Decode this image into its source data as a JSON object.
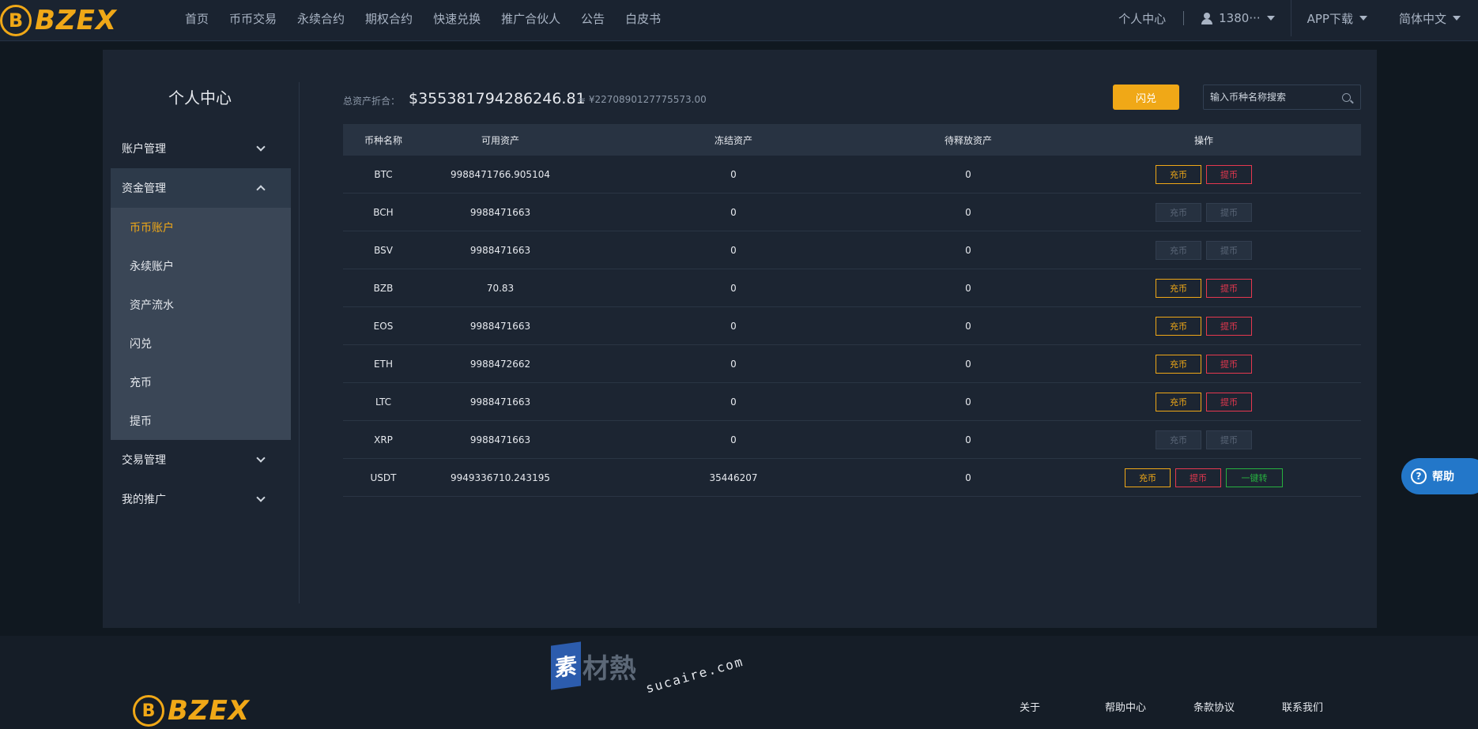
{
  "brand": {
    "name": "BZEX",
    "mark": "B"
  },
  "nav": {
    "items": [
      "首页",
      "币币交易",
      "永续合约",
      "期权合约",
      "快速兑换",
      "推广合伙人",
      "公告",
      "白皮书"
    ],
    "personal_center": "个人中心",
    "user": "1380···",
    "app_download": "APP下载",
    "language": "简体中文"
  },
  "sidebar": {
    "title": "个人中心",
    "groups": [
      {
        "label": "账户管理",
        "open": false
      },
      {
        "label": "资金管理",
        "open": true,
        "items": [
          "币币账户",
          "永续账户",
          "资产流水",
          "闪兑",
          "充币",
          "提币"
        ],
        "active": "币币账户"
      },
      {
        "label": "交易管理",
        "open": false
      },
      {
        "label": "我的推广",
        "open": false
      }
    ]
  },
  "summary": {
    "label": "总资产折合：",
    "usd": "$355381794286246.81",
    "cny": "≈ ¥2270890127775573.00",
    "flash_button": "闪兑",
    "search_placeholder": "输入币种名称搜索"
  },
  "table": {
    "headers": [
      "币种名称",
      "可用资产",
      "冻结资产",
      "待释放资产",
      "操作"
    ],
    "deposit_label": "充币",
    "withdraw_label": "提币",
    "transfer_label": "一键转",
    "rows": [
      {
        "coin": "BTC",
        "available": "9988471766.905104",
        "frozen": "0",
        "pending": "0",
        "enabled": true,
        "transfer": false
      },
      {
        "coin": "BCH",
        "available": "9988471663",
        "frozen": "0",
        "pending": "0",
        "enabled": false,
        "transfer": false
      },
      {
        "coin": "BSV",
        "available": "9988471663",
        "frozen": "0",
        "pending": "0",
        "enabled": false,
        "transfer": false
      },
      {
        "coin": "BZB",
        "available": "70.83",
        "frozen": "0",
        "pending": "0",
        "enabled": true,
        "transfer": false
      },
      {
        "coin": "EOS",
        "available": "9988471663",
        "frozen": "0",
        "pending": "0",
        "enabled": true,
        "transfer": false
      },
      {
        "coin": "ETH",
        "available": "9988472662",
        "frozen": "0",
        "pending": "0",
        "enabled": true,
        "transfer": false
      },
      {
        "coin": "LTC",
        "available": "9988471663",
        "frozen": "0",
        "pending": "0",
        "enabled": true,
        "transfer": false
      },
      {
        "coin": "XRP",
        "available": "9988471663",
        "frozen": "0",
        "pending": "0",
        "enabled": false,
        "transfer": false
      },
      {
        "coin": "USDT",
        "available": "9949336710.243195",
        "frozen": "35446207",
        "pending": "0",
        "enabled": true,
        "transfer": true
      }
    ]
  },
  "help": {
    "label": "帮助",
    "icon": "question-icon"
  },
  "footer": {
    "links": [
      "关于",
      "帮助中心",
      "条款协议",
      "联系我们"
    ]
  },
  "watermark": {
    "box": "素",
    "cn": "材熱",
    "url": "sucaire.com"
  },
  "colors": {
    "accent": "#f0a817",
    "danger": "#e6384f",
    "success": "#27b13f",
    "help": "#2377c9"
  }
}
